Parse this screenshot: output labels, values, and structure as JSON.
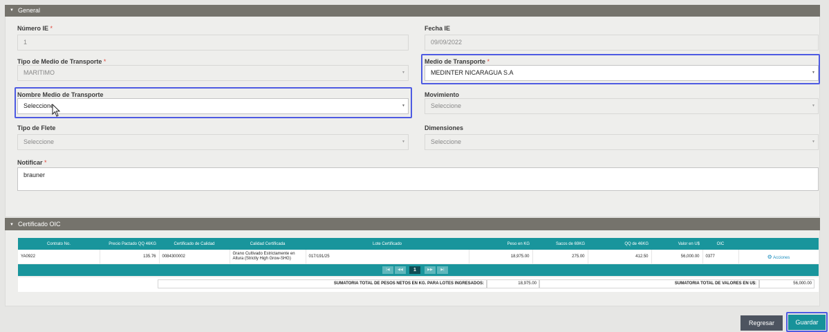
{
  "general": {
    "header": "General",
    "numero_ie": {
      "label": "Número IE",
      "value": "1"
    },
    "fecha_ie": {
      "label": "Fecha IE",
      "value": "09/09/2022"
    },
    "tipo_medio": {
      "label": "Tipo de Medio de Transporte",
      "value": "MARITIMO"
    },
    "medio": {
      "label": "Medio de Transporte",
      "value": "MEDINTER NICARAGUA S.A"
    },
    "nombre_medio": {
      "label": "Nombre Medio de Transporte",
      "value": "Seleccione"
    },
    "movimiento": {
      "label": "Movimiento",
      "value": "Seleccione"
    },
    "tipo_flete": {
      "label": "Tipo de Flete",
      "value": "Seleccione"
    },
    "dimensiones": {
      "label": "Dimensiones",
      "value": "Seleccione"
    },
    "notificar": {
      "label": "Notificar",
      "value": "brauner"
    },
    "required_mark": "*"
  },
  "certificado": {
    "header": "Certificado OIC",
    "columns": [
      "Contrato No.",
      "Precio Pactado QQ 46KG",
      "Certificado de Calidad",
      "Calidad Certificada",
      "Lote Certificado",
      "Peso en KG",
      "Sacos de 69KG",
      "QQ de 46KG",
      "Valor en U$",
      "OIC",
      ""
    ],
    "row": {
      "contrato": "YA0922",
      "precio": "135.76",
      "certificado": "0084300002",
      "calidad": "Grano Cultivado Estrictamente en Altura (Strictly High Grow-SHG)",
      "lote": "017/191/25",
      "peso": "18,975.00",
      "sacos": "275.00",
      "qq": "412.50",
      "valor": "56,000.00",
      "oic": "0377",
      "acciones": "Acciones"
    },
    "pager": {
      "first": "|◀",
      "prev": "◀◀",
      "page": "1",
      "next": "▶▶",
      "last": "▶|"
    },
    "totals": {
      "peso_label": "SUMATORIA TOTAL DE PESOS NETOS EN KG. PARA LOTES INGRESADOS:",
      "peso_value": "18,975.00",
      "valor_label": "SUMATORIA TOTAL DE VALORES EN U$:",
      "valor_value": "56,000.00"
    }
  },
  "buttons": {
    "regresar": "Regresar",
    "guardar": "Guardar"
  },
  "colors": {
    "header_gray": "#75736c",
    "teal": "#19959c",
    "highlight_blue": "#4d5ae2",
    "required_red": "#e0453a",
    "dark_button": "#4d5460"
  }
}
